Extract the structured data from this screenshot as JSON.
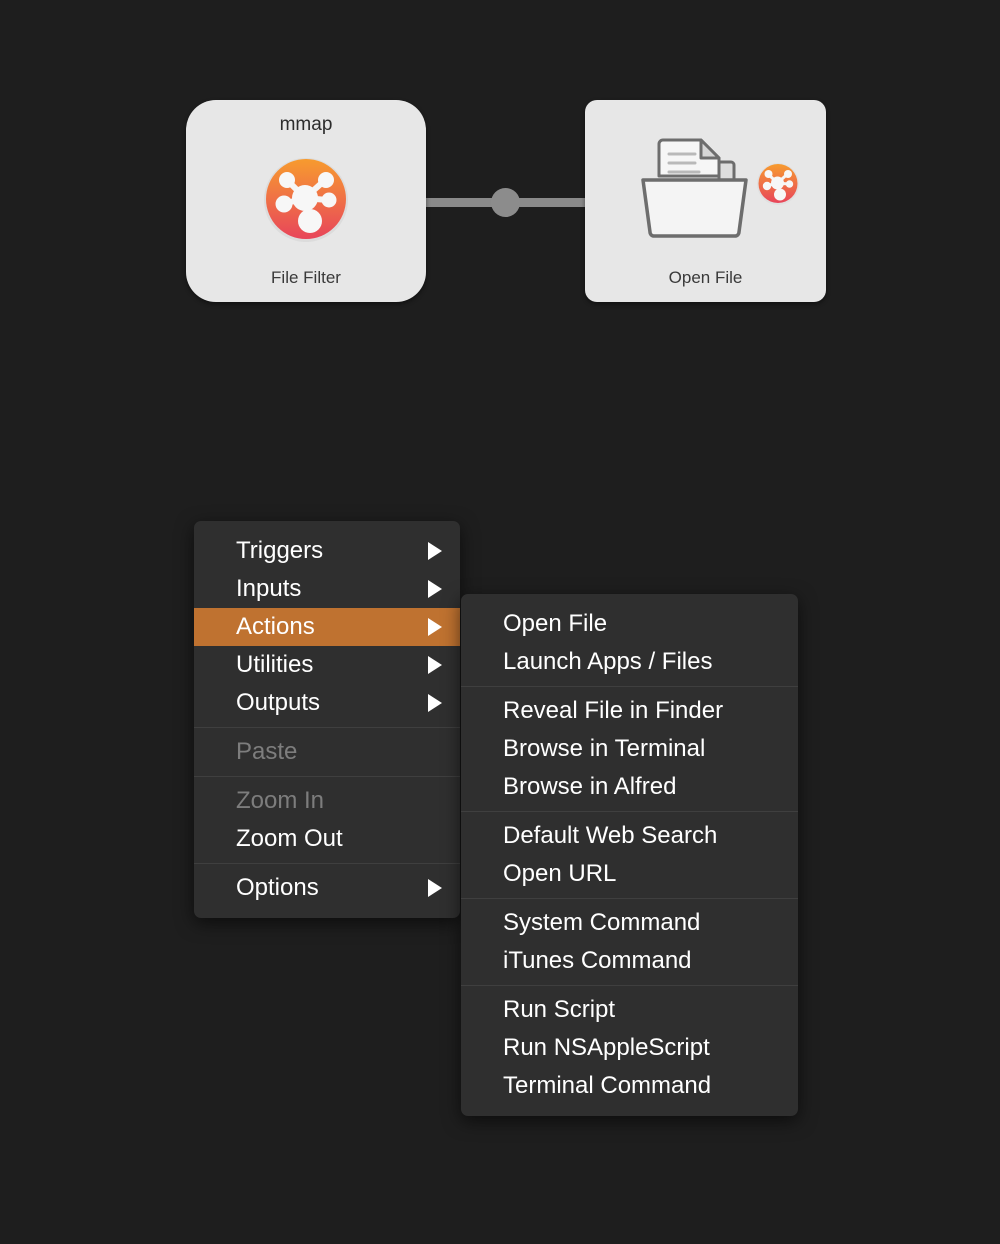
{
  "app": {
    "background_color": "#1e1e1e",
    "accent_color": "#bf7230",
    "menu_background": "#2f2f2f",
    "node_card_color": "#e7e7e7",
    "connector_color": "#8a8a8a"
  },
  "canvas": {
    "nodes": [
      {
        "id": "file-filter",
        "title": "mmap",
        "subtitle": "File Filter",
        "icon": "mindnode-icon"
      },
      {
        "id": "open-file",
        "title": "",
        "subtitle": "Open File",
        "icon": "folder-document-icon",
        "badge_icon": "mindnode-icon"
      }
    ],
    "connector": {
      "icon": "connector-knob-icon"
    }
  },
  "context_menu": {
    "groups": [
      {
        "items": [
          {
            "label": "Triggers",
            "submenu": true,
            "disabled": false,
            "highlighted": false
          },
          {
            "label": "Inputs",
            "submenu": true,
            "disabled": false,
            "highlighted": false
          },
          {
            "label": "Actions",
            "submenu": true,
            "disabled": false,
            "highlighted": true
          },
          {
            "label": "Utilities",
            "submenu": true,
            "disabled": false,
            "highlighted": false
          },
          {
            "label": "Outputs",
            "submenu": true,
            "disabled": false,
            "highlighted": false
          }
        ]
      },
      {
        "items": [
          {
            "label": "Paste",
            "submenu": false,
            "disabled": true,
            "highlighted": false
          }
        ]
      },
      {
        "items": [
          {
            "label": "Zoom In",
            "submenu": false,
            "disabled": true,
            "highlighted": false
          },
          {
            "label": "Zoom Out",
            "submenu": false,
            "disabled": false,
            "highlighted": false
          }
        ]
      },
      {
        "items": [
          {
            "label": "Options",
            "submenu": true,
            "disabled": false,
            "highlighted": false
          }
        ]
      }
    ]
  },
  "actions_submenu": {
    "groups": [
      {
        "items": [
          {
            "label": "Open File",
            "submenu": false,
            "disabled": false,
            "highlighted": false
          },
          {
            "label": "Launch Apps / Files",
            "submenu": false,
            "disabled": false,
            "highlighted": false
          }
        ]
      },
      {
        "items": [
          {
            "label": "Reveal File in Finder",
            "submenu": false,
            "disabled": false,
            "highlighted": false
          },
          {
            "label": "Browse in Terminal",
            "submenu": false,
            "disabled": false,
            "highlighted": false
          },
          {
            "label": "Browse in Alfred",
            "submenu": false,
            "disabled": false,
            "highlighted": false
          }
        ]
      },
      {
        "items": [
          {
            "label": "Default Web Search",
            "submenu": false,
            "disabled": false,
            "highlighted": false
          },
          {
            "label": "Open URL",
            "submenu": false,
            "disabled": false,
            "highlighted": false
          }
        ]
      },
      {
        "items": [
          {
            "label": "System Command",
            "submenu": false,
            "disabled": false,
            "highlighted": false
          },
          {
            "label": "iTunes Command",
            "submenu": false,
            "disabled": false,
            "highlighted": false
          }
        ]
      },
      {
        "items": [
          {
            "label": "Run Script",
            "submenu": false,
            "disabled": false,
            "highlighted": false
          },
          {
            "label": "Run NSAppleScript",
            "submenu": false,
            "disabled": false,
            "highlighted": false
          },
          {
            "label": "Terminal Command",
            "submenu": false,
            "disabled": false,
            "highlighted": false
          }
        ]
      }
    ]
  }
}
